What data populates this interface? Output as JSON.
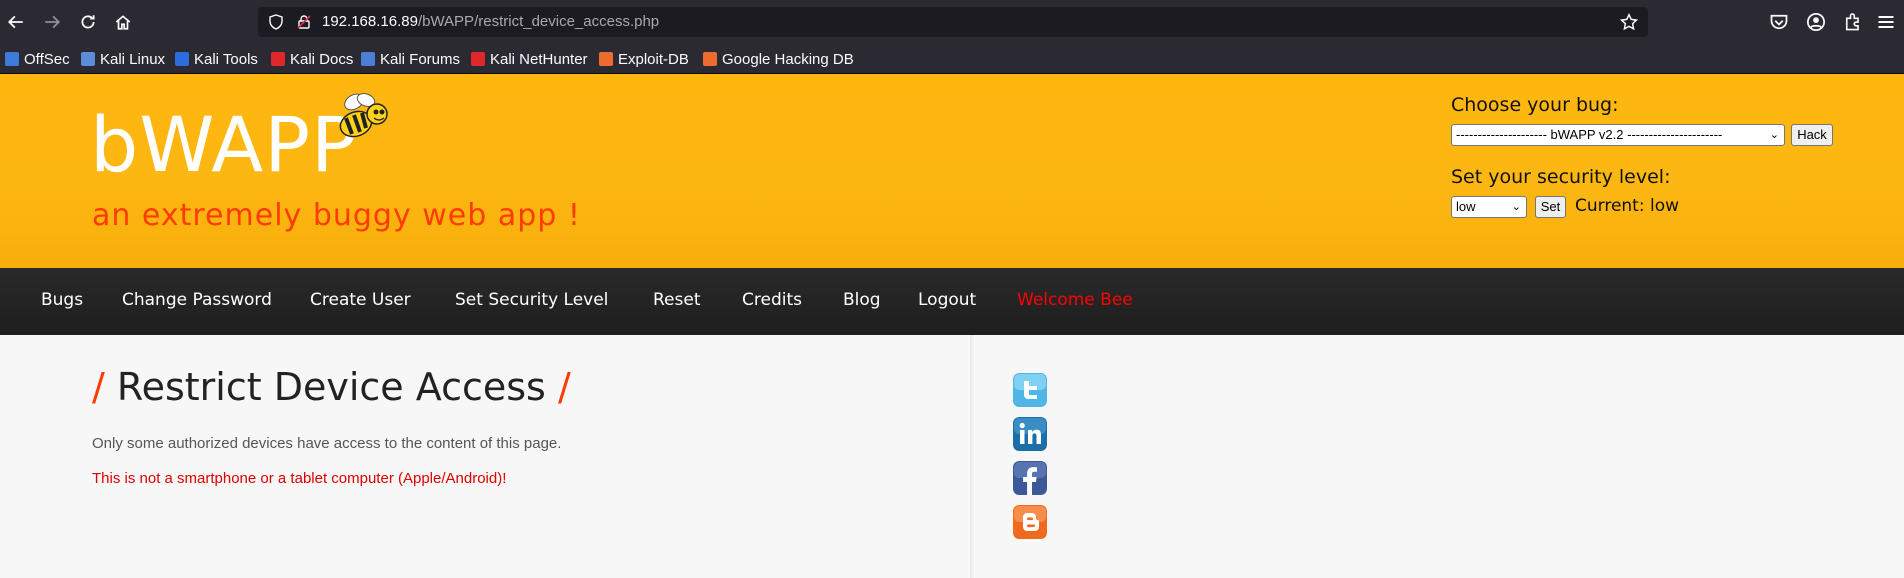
{
  "browser": {
    "url_host": "192.168.16.89",
    "url_path": "/bWAPP/restrict_device_access.php",
    "bookmarks": [
      {
        "label": "OffSec",
        "color": "#3c7bd9"
      },
      {
        "label": "Kali Linux",
        "color": "#5b8dd9"
      },
      {
        "label": "Kali Tools",
        "color": "#2d6cdf"
      },
      {
        "label": "Kali Docs",
        "color": "#e0282c"
      },
      {
        "label": "Kali Forums",
        "color": "#4a7fd6"
      },
      {
        "label": "Kali NetHunter",
        "color": "#e0282c"
      },
      {
        "label": "Exploit-DB",
        "color": "#ec6b2f"
      },
      {
        "label": "Google Hacking DB",
        "color": "#ec6b2f"
      }
    ]
  },
  "header": {
    "logo": "bWAPP",
    "tagline": "an extremely buggy web app !",
    "choose_label": "Choose your bug:",
    "bug_selected": "--------------------- bWAPP v2.2 ----------------------",
    "hack_button": "Hack",
    "security_label": "Set your security level:",
    "security_selected": "low",
    "set_button": "Set",
    "current_level": "Current: low"
  },
  "menu": {
    "items": [
      "Bugs",
      "Change Password",
      "Create User",
      "Set Security Level",
      "Reset",
      "Credits",
      "Blog",
      "Logout"
    ],
    "welcome": "Welcome Bee"
  },
  "content": {
    "title": "Restrict Device Access",
    "title_slash": "/",
    "intro": "Only some authorized devices have access to the content of this page.",
    "message": "This is not a smartphone or a tablet computer (Apple/Android)!"
  },
  "colors": {
    "header_bg": "#ffb70f",
    "accent_orange": "#ff3c00",
    "error_red": "#e00000",
    "menu_bg": "#1e1e1e"
  },
  "social_icons": [
    "twitter-icon",
    "linkedin-icon",
    "facebook-icon",
    "blogger-icon"
  ]
}
